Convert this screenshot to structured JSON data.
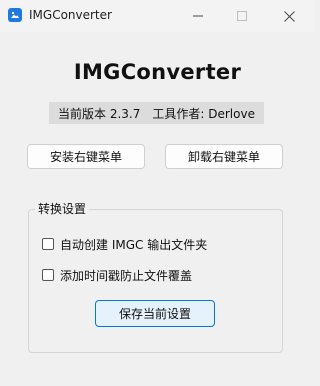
{
  "window": {
    "title": "IMGConverter",
    "minimize_icon": "minimize-icon",
    "maximize_icon": "maximize-icon",
    "close_icon": "close-icon"
  },
  "header": {
    "app_name": "IMGConverter",
    "version_text": "当前版本 2.3.7",
    "author_text": "工具作者: Derlove"
  },
  "actions": {
    "install_label": "安装右键菜单",
    "uninstall_label": "卸载右键菜单"
  },
  "settings": {
    "group_title": "转换设置",
    "options": [
      {
        "label": "自动创建 IMGC 输出文件夹",
        "checked": false
      },
      {
        "label": "添加时间戳防止文件覆盖",
        "checked": false
      }
    ],
    "save_label": "保存当前设置"
  },
  "colors": {
    "accent": "#0078d4",
    "app_icon": "#1f7ae0",
    "background": "#f0f0f0"
  }
}
